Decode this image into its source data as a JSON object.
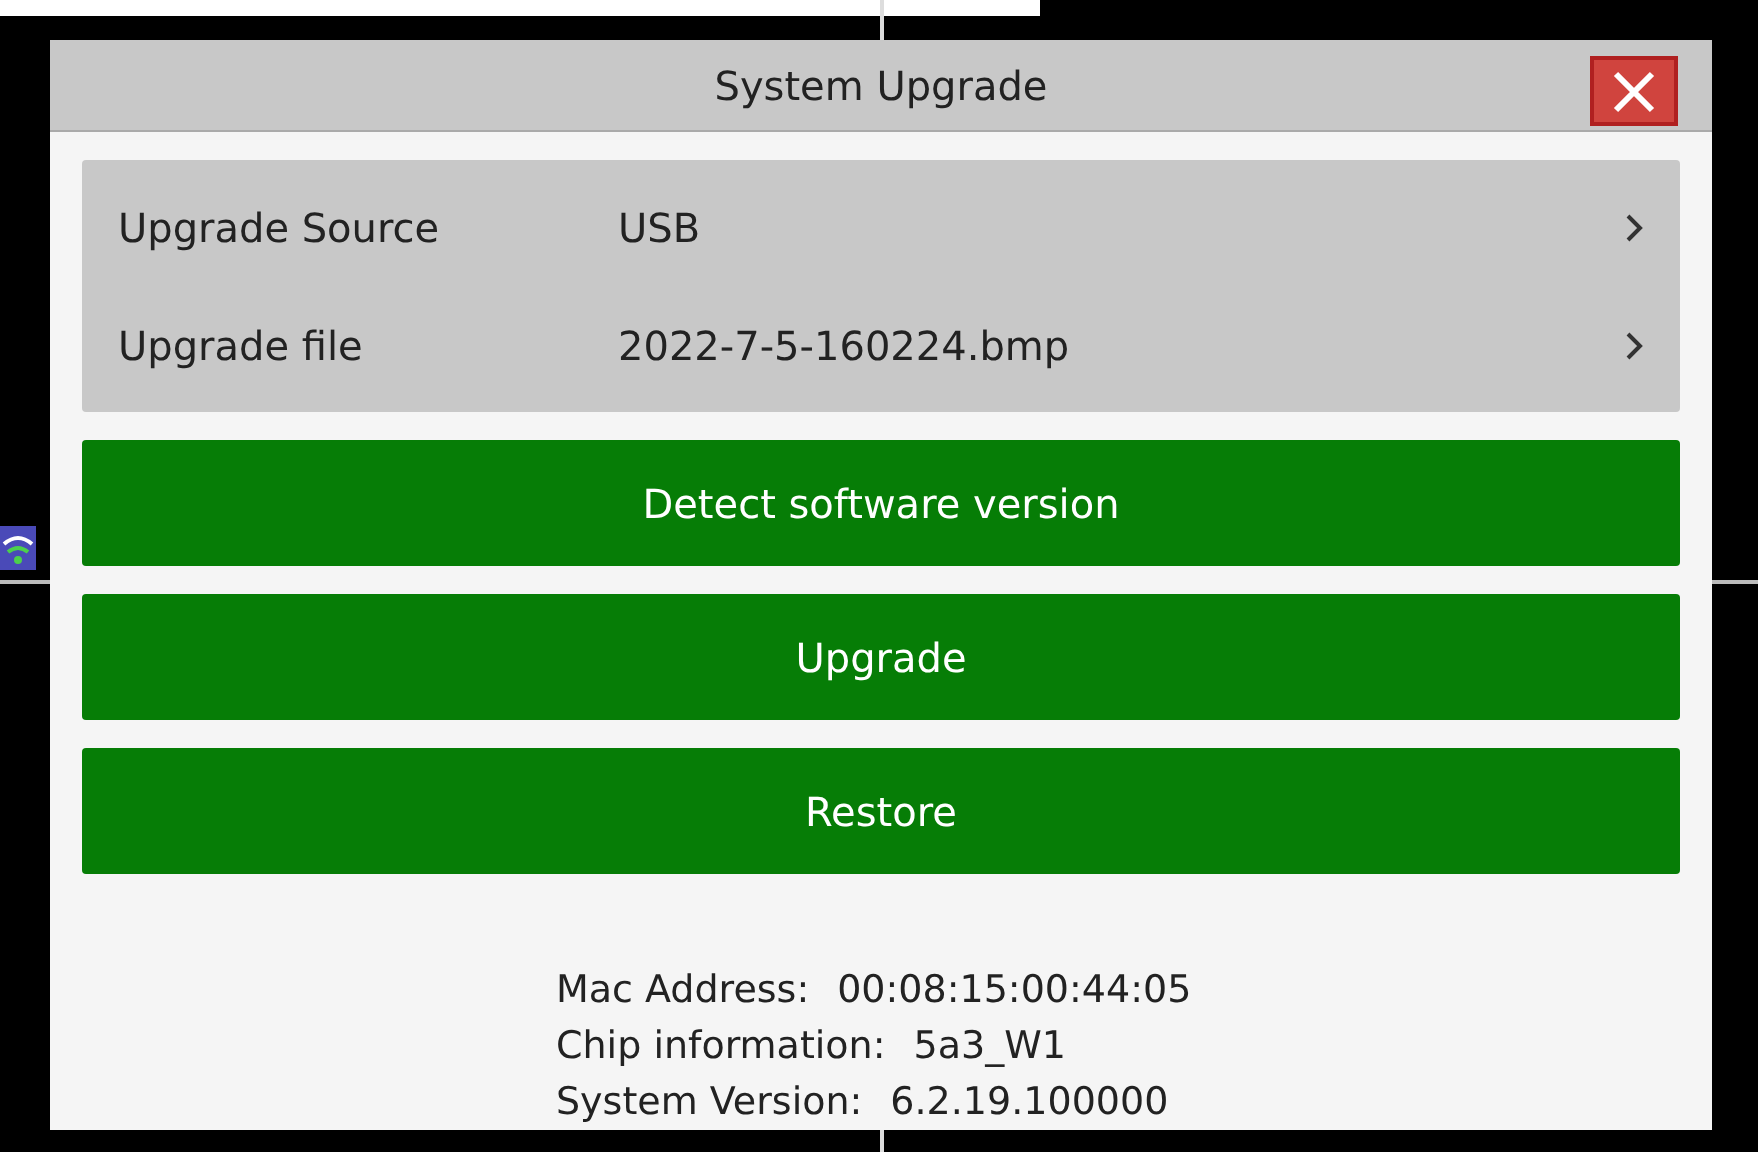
{
  "window": {
    "title": "System Upgrade"
  },
  "settings": [
    {
      "label": "Upgrade Source",
      "value": "USB"
    },
    {
      "label": "Upgrade file",
      "value": "2022-7-5-160224.bmp"
    }
  ],
  "buttons": [
    "Detect software version",
    "Upgrade",
    "Restore"
  ],
  "info": [
    {
      "label": "Mac Address:",
      "value": "00:08:15:00:44:05"
    },
    {
      "label": "Chip information:",
      "value": "5a3_W1"
    },
    {
      "label": "System Version:",
      "value": "6.2.19.100000"
    }
  ]
}
